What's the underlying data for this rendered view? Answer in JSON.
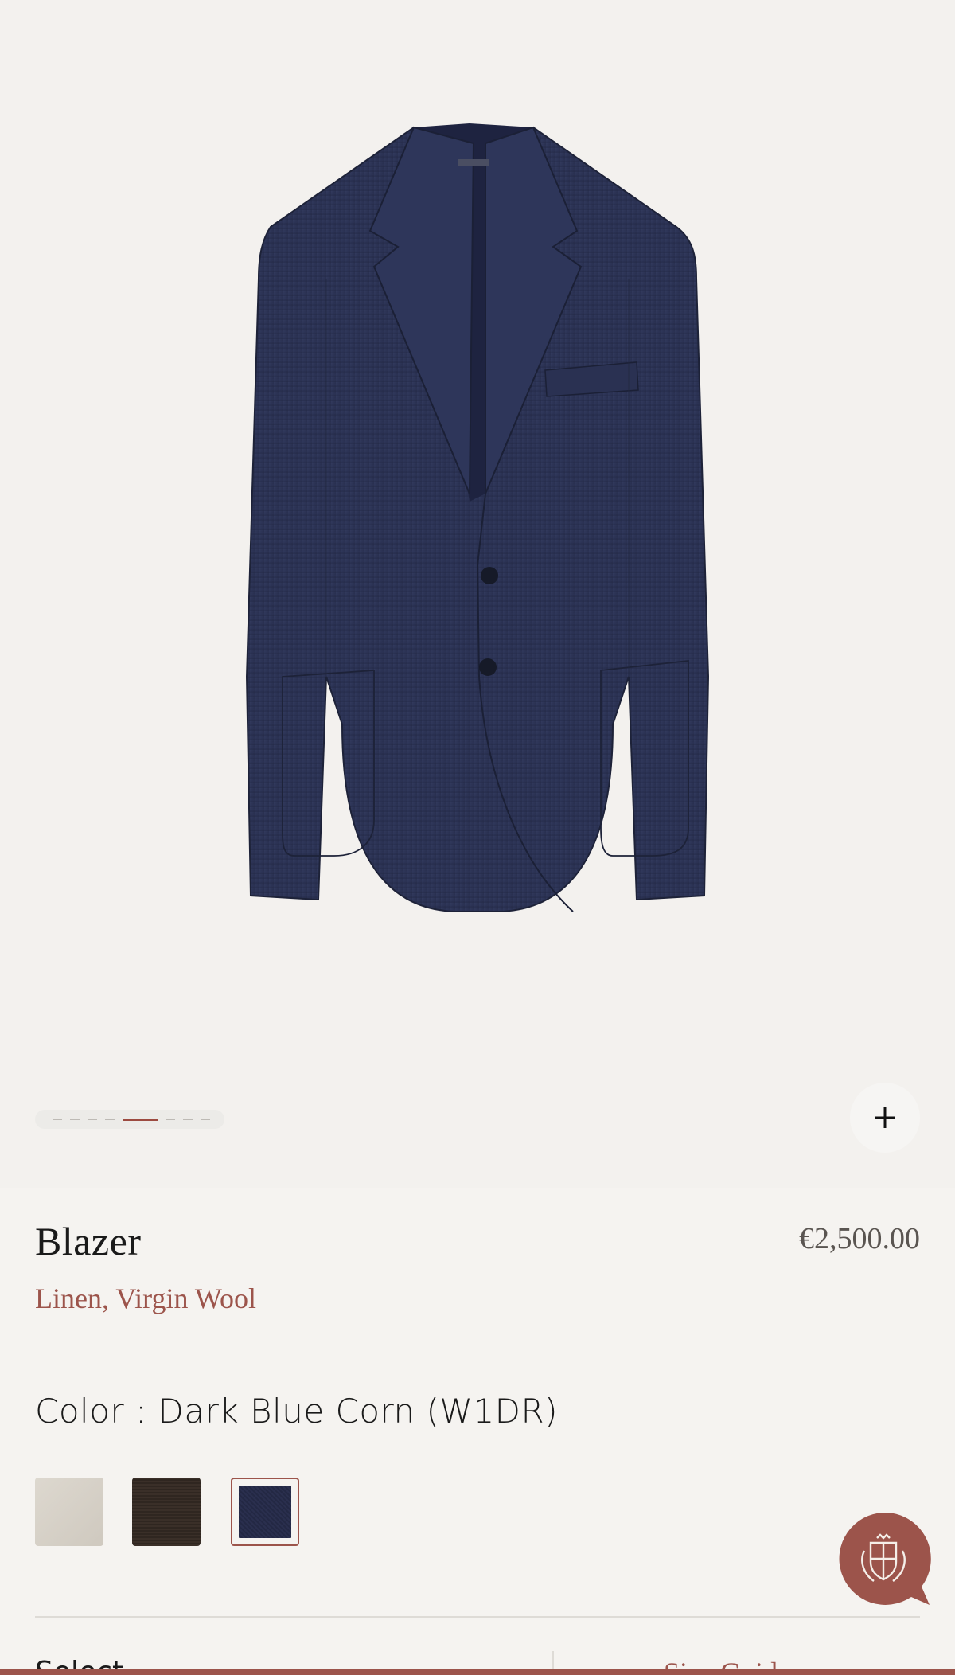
{
  "product": {
    "name": "Blazer",
    "price": "€2,500.00",
    "material": "Linen, Virgin Wool"
  },
  "color": {
    "label": "Color : Dark Blue Corn (W1DR)",
    "swatches": [
      {
        "name": "beige",
        "hex": "#d8d3ca",
        "selected": false
      },
      {
        "name": "brown",
        "hex": "#352b24",
        "selected": false
      },
      {
        "name": "dark-blue",
        "hex": "#262b47",
        "selected": true
      }
    ]
  },
  "gallery": {
    "slides_total": 9,
    "active_slide": 5,
    "zoom_icon": "plus-icon"
  },
  "size": {
    "select_label": "Select",
    "guide_label": "Size Guide"
  },
  "colors": {
    "accent": "#9c544b",
    "jacket": "#2b3254"
  }
}
